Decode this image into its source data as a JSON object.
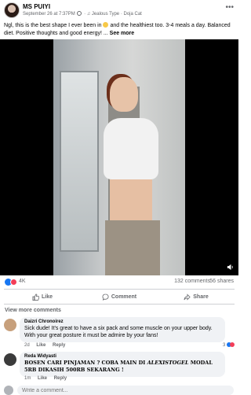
{
  "post": {
    "author": "MS PUIYI",
    "date": "September 26 at 7:37PM",
    "separator": "·",
    "music": "♫ Jealous Type · Doja Cat",
    "caption_part1": "Ngl, this is the best shape I ever been in",
    "caption_part2": "and the healthiest too. 3-4 meals a day. Balanced diet. Positive thoughts and good energy! ...",
    "see_more": "See more"
  },
  "stats": {
    "reactions": "4K",
    "comments": "132 comments",
    "shares": "56 shares"
  },
  "actions": {
    "like": "Like",
    "comment": "Comment",
    "share": "Share"
  },
  "view_more_comments": "View more comments",
  "comments": [
    {
      "name": "Daizri Chronoirez",
      "text": "Sick dude! It's great to have a six pack and some muscle on your upper body. With your great posture it must be admire by your fans!",
      "time": "2d",
      "like": "Like",
      "reply": "Reply",
      "reactions": "3"
    },
    {
      "name": "Reda Widyasti",
      "text_a": "BOSEN CARI PINJAMAN ? COBA MAIN DI ",
      "text_b": "ALEXISTOGEL",
      "text_c": " MODAL 5RB DIKASIH 500RB SEKARANG !",
      "time": "1m",
      "like": "Like",
      "reply": "Reply"
    }
  ],
  "write_placeholder": "Write a comment...",
  "colors": {
    "accent": "#1877f2",
    "love": "#f33e58",
    "muted": "#65676b"
  }
}
